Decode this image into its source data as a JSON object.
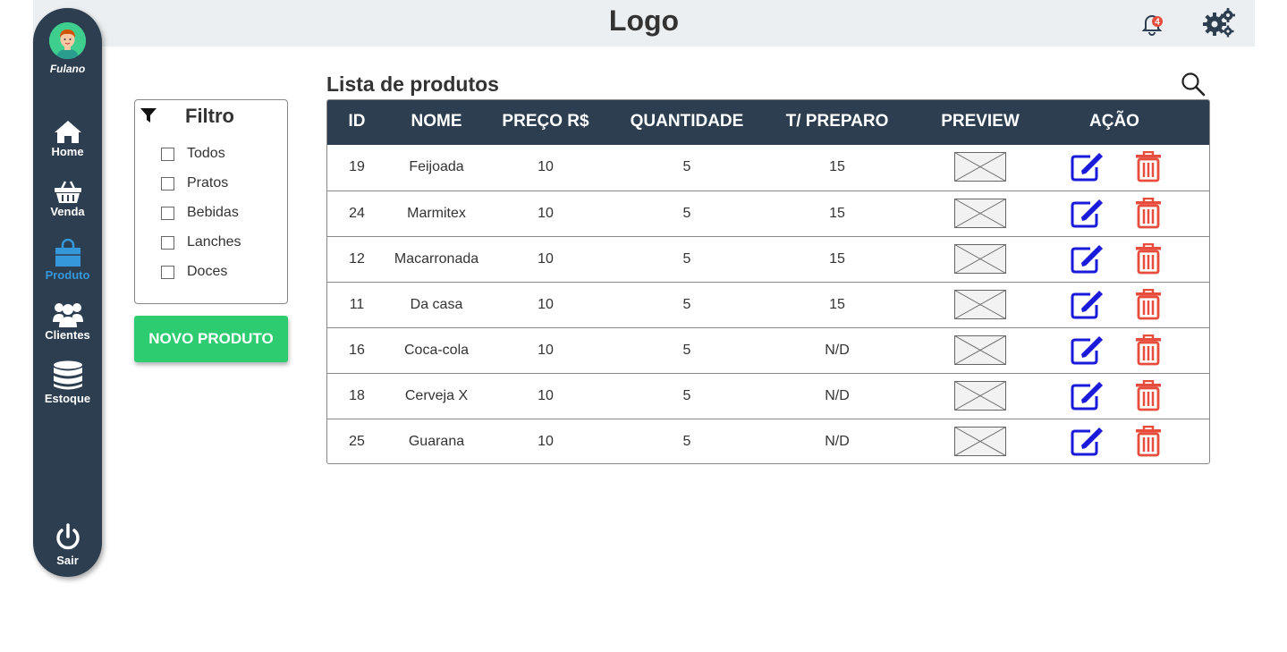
{
  "header": {
    "logo": "Logo",
    "notifications_count": "4"
  },
  "sidebar": {
    "user_name": "Fulano",
    "items": [
      {
        "label": "Home",
        "icon": "home-icon"
      },
      {
        "label": "Venda",
        "icon": "basket-icon"
      },
      {
        "label": "Produto",
        "icon": "bag-icon",
        "active": true
      },
      {
        "label": "Clientes",
        "icon": "users-icon"
      },
      {
        "label": "Estoque",
        "icon": "database-icon"
      }
    ],
    "logout_label": "Sair"
  },
  "filter": {
    "title": "Filtro",
    "options": [
      "Todos",
      "Pratos",
      "Bebidas",
      "Lanches",
      "Doces"
    ]
  },
  "new_product_label": "NOVO PRODUTO",
  "list": {
    "title": "Lista de produtos",
    "columns": [
      "ID",
      "NOME",
      "PREÇO R$",
      "QUANTIDADE",
      "T/ PREPARO",
      "PREVIEW",
      "AÇÃO"
    ],
    "rows": [
      {
        "id": "19",
        "name": "Feijoada",
        "price": "10",
        "quantity": "5",
        "prep": "15"
      },
      {
        "id": "24",
        "name": "Marmitex",
        "price": "10",
        "quantity": "5",
        "prep": "15"
      },
      {
        "id": "12",
        "name": "Macarronada",
        "price": "10",
        "quantity": "5",
        "prep": "15"
      },
      {
        "id": "11",
        "name": "Da casa",
        "price": "10",
        "quantity": "5",
        "prep": "15"
      },
      {
        "id": "16",
        "name": "Coca-cola",
        "price": "10",
        "quantity": "5",
        "prep": "N/D"
      },
      {
        "id": "18",
        "name": "Cerveja X",
        "price": "10",
        "quantity": "5",
        "prep": "N/D"
      },
      {
        "id": "25",
        "name": "Guarana",
        "price": "10",
        "quantity": "5",
        "prep": "N/D"
      }
    ]
  },
  "colors": {
    "sidebar_bg": "#2c3e50",
    "active_nav": "#3498db",
    "button_green": "#2ecc71",
    "edit_blue": "#1a1adb",
    "delete_red": "#e74c3c",
    "badge_red": "#e74c3c"
  }
}
